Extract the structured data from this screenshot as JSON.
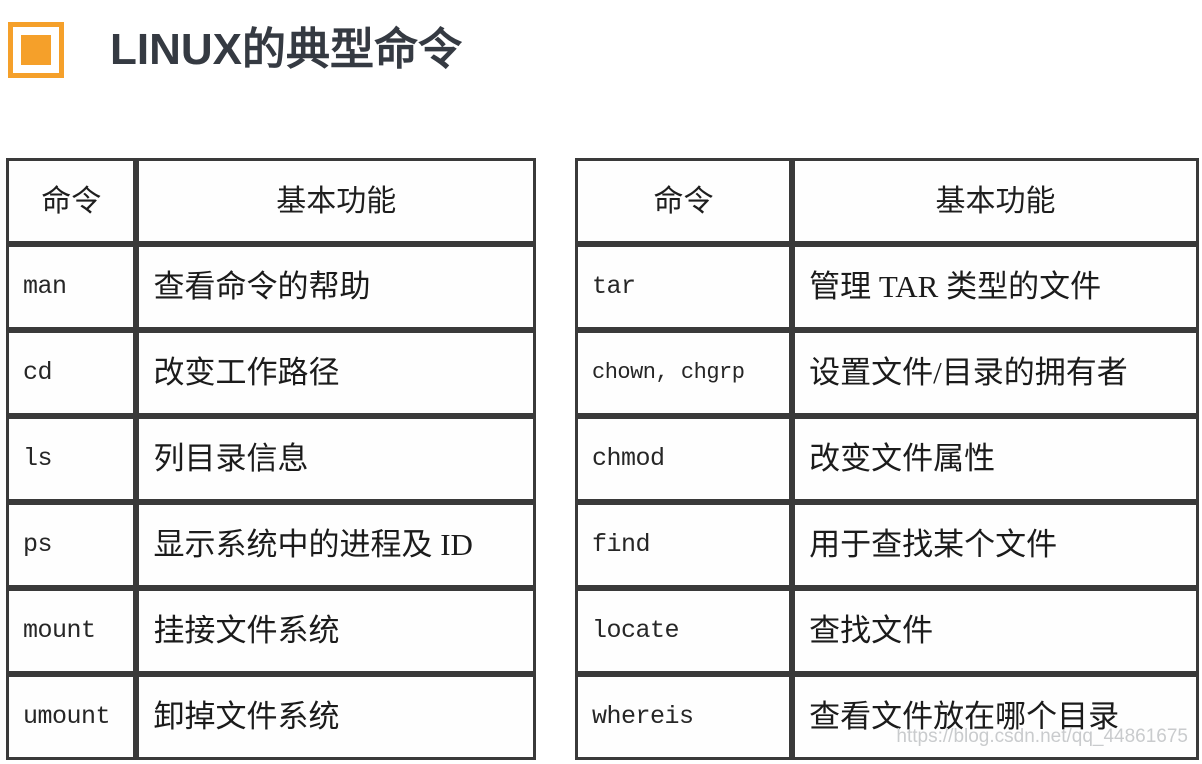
{
  "header": {
    "title": "LINUX的典型命令",
    "bullet_icon": "orange-square-icon",
    "accent_color": "#F5A02A",
    "title_color": "#353A42"
  },
  "tables": {
    "columns": [
      "命令",
      "基本功能"
    ],
    "left": {
      "headers": {
        "command": "命令",
        "function": "基本功能"
      },
      "rows": [
        {
          "command": "man",
          "function": "查看命令的帮助"
        },
        {
          "command": "cd",
          "function": "改变工作路径"
        },
        {
          "command": "ls",
          "function": "列目录信息"
        },
        {
          "command": "ps",
          "function": "显示系统中的进程及 ID"
        },
        {
          "command": "mount",
          "function": "挂接文件系统"
        },
        {
          "command": "umount",
          "function": "卸掉文件系统"
        }
      ]
    },
    "right": {
      "headers": {
        "command": "命令",
        "function": "基本功能"
      },
      "rows": [
        {
          "command": "tar",
          "function": "管理 TAR 类型的文件"
        },
        {
          "command": "chown, chgrp",
          "function": "设置文件/目录的拥有者"
        },
        {
          "command": "chmod",
          "function": "改变文件属性"
        },
        {
          "command": "find",
          "function": "用于查找某个文件"
        },
        {
          "command": "locate",
          "function": "查找文件"
        },
        {
          "command": "whereis",
          "function": "查看文件放在哪个目录"
        }
      ]
    }
  },
  "watermark": {
    "text": "https://blog.csdn.net/qq_44861675"
  }
}
